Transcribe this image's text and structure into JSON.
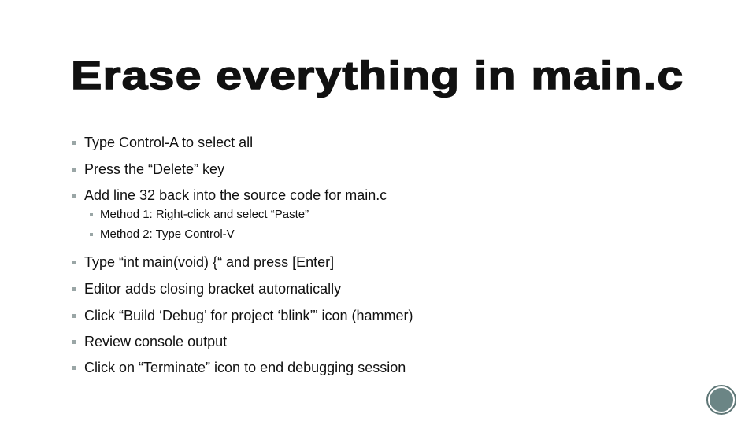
{
  "slide": {
    "title": "Erase everything in main.c",
    "bullets": [
      {
        "text": "Type Control-A to select all"
      },
      {
        "text": "Press the “Delete” key"
      },
      {
        "text": "Add line 32 back into the source code for main.c",
        "sub": [
          {
            "text": "Method 1:  Right-click and select “Paste”"
          },
          {
            "text": "Method 2:  Type Control-V"
          }
        ]
      },
      {
        "text": "Type “int main(void) {“ and press [Enter]"
      },
      {
        "text": "Editor adds closing bracket automatically"
      },
      {
        "text": "Click “Build ‘Debug’ for project ‘blink’” icon (hammer)"
      },
      {
        "text": "Review console output"
      },
      {
        "text": "Click on “Terminate” icon to end debugging session"
      }
    ],
    "bullet_icon": "square-bullet-icon",
    "nav_icon": "circle-nav-icon",
    "colors": {
      "text": "#111111",
      "bullet": "#9aa6a6",
      "accent": "#6b8585"
    }
  }
}
